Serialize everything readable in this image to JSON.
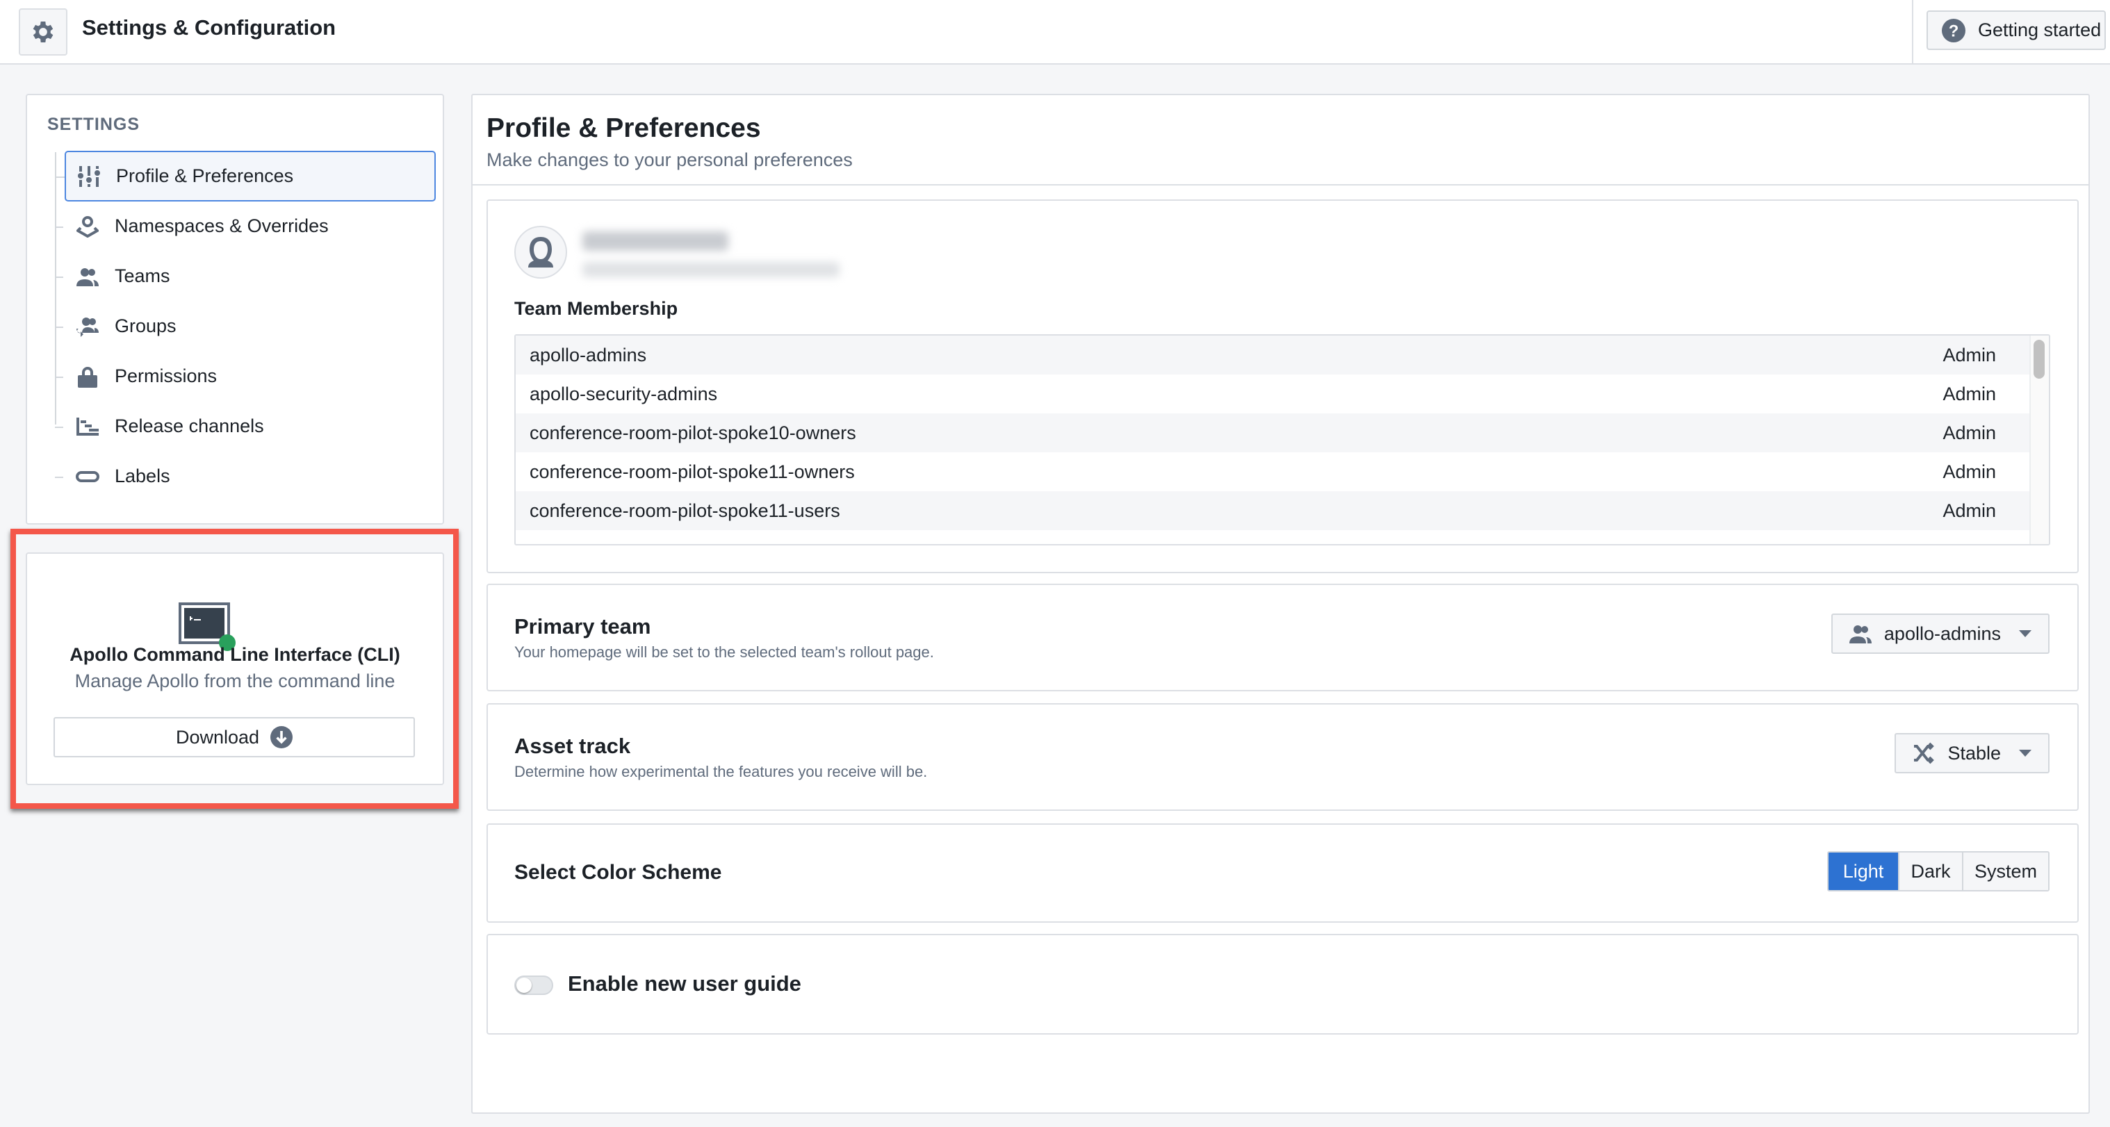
{
  "header": {
    "title": "Settings & Configuration",
    "getting_started": "Getting started"
  },
  "sidebar": {
    "section_label": "SETTINGS",
    "items": [
      {
        "label": "Profile & Preferences",
        "icon": "sliders-icon",
        "selected": true
      },
      {
        "label": "Namespaces & Overrides",
        "icon": "map-marker-icon"
      },
      {
        "label": "Teams",
        "icon": "people-icon"
      },
      {
        "label": "Groups",
        "icon": "group-icon"
      },
      {
        "label": "Permissions",
        "icon": "lock-icon"
      },
      {
        "label": "Release channels",
        "icon": "release-channels-icon"
      },
      {
        "label": "Labels",
        "icon": "label-icon"
      }
    ]
  },
  "cli": {
    "title": "Apollo Command Line Interface (CLI)",
    "subtitle": "Manage Apollo from the command line",
    "download": "Download"
  },
  "main": {
    "title": "Profile & Preferences",
    "subtitle": "Make changes to your personal preferences",
    "team_membership": {
      "label": "Team Membership",
      "rows": [
        {
          "name": "apollo-admins",
          "role": "Admin"
        },
        {
          "name": "apollo-security-admins",
          "role": "Admin"
        },
        {
          "name": "conference-room-pilot-spoke10-owners",
          "role": "Admin"
        },
        {
          "name": "conference-room-pilot-spoke11-owners",
          "role": "Admin"
        },
        {
          "name": "conference-room-pilot-spoke11-users",
          "role": "Admin"
        }
      ]
    },
    "primary_team": {
      "title": "Primary team",
      "desc": "Your homepage will be set to the selected team's rollout page.",
      "value": "apollo-admins"
    },
    "asset_track": {
      "title": "Asset track",
      "desc": "Determine how experimental the features you receive will be.",
      "value": "Stable"
    },
    "color_scheme": {
      "title": "Select Color Scheme",
      "options": [
        "Light",
        "Dark",
        "System"
      ],
      "selected": "Light"
    },
    "user_guide": {
      "label": "Enable new user guide",
      "enabled": false
    }
  },
  "colors": {
    "accent": "#2d72d2",
    "highlight": "#f4574a",
    "status_green": "#29a05c"
  }
}
